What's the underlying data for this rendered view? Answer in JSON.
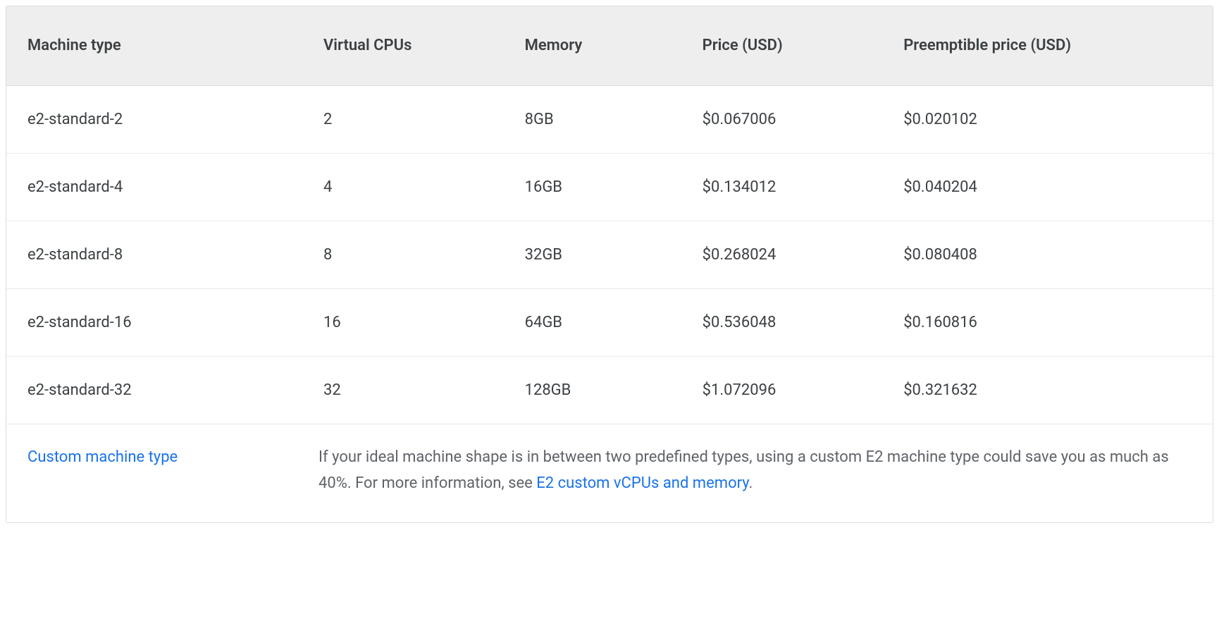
{
  "table": {
    "headers": {
      "machine_type": "Machine type",
      "vcpus": "Virtual CPUs",
      "memory": "Memory",
      "price": "Price (USD)",
      "preemptible_price": "Preemptible price (USD)"
    },
    "rows": [
      {
        "machine_type": "e2-standard-2",
        "vcpus": "2",
        "memory": "8GB",
        "price": "$0.067006",
        "preemptible_price": "$0.020102"
      },
      {
        "machine_type": "e2-standard-4",
        "vcpus": "4",
        "memory": "16GB",
        "price": "$0.134012",
        "preemptible_price": "$0.040204"
      },
      {
        "machine_type": "e2-standard-8",
        "vcpus": "8",
        "memory": "32GB",
        "price": "$0.268024",
        "preemptible_price": "$0.080408"
      },
      {
        "machine_type": "e2-standard-16",
        "vcpus": "16",
        "memory": "64GB",
        "price": "$0.536048",
        "preemptible_price": "$0.160816"
      },
      {
        "machine_type": "e2-standard-32",
        "vcpus": "32",
        "memory": "128GB",
        "price": "$1.072096",
        "preemptible_price": "$0.321632"
      }
    ],
    "footer": {
      "link_label": "Custom machine type",
      "desc_before": "If your ideal machine shape is in between two predefined types, using a custom E2 machine type could save you as much as 40%. For more information, see ",
      "desc_link": "E2 custom vCPUs and memory",
      "desc_after": "."
    }
  }
}
